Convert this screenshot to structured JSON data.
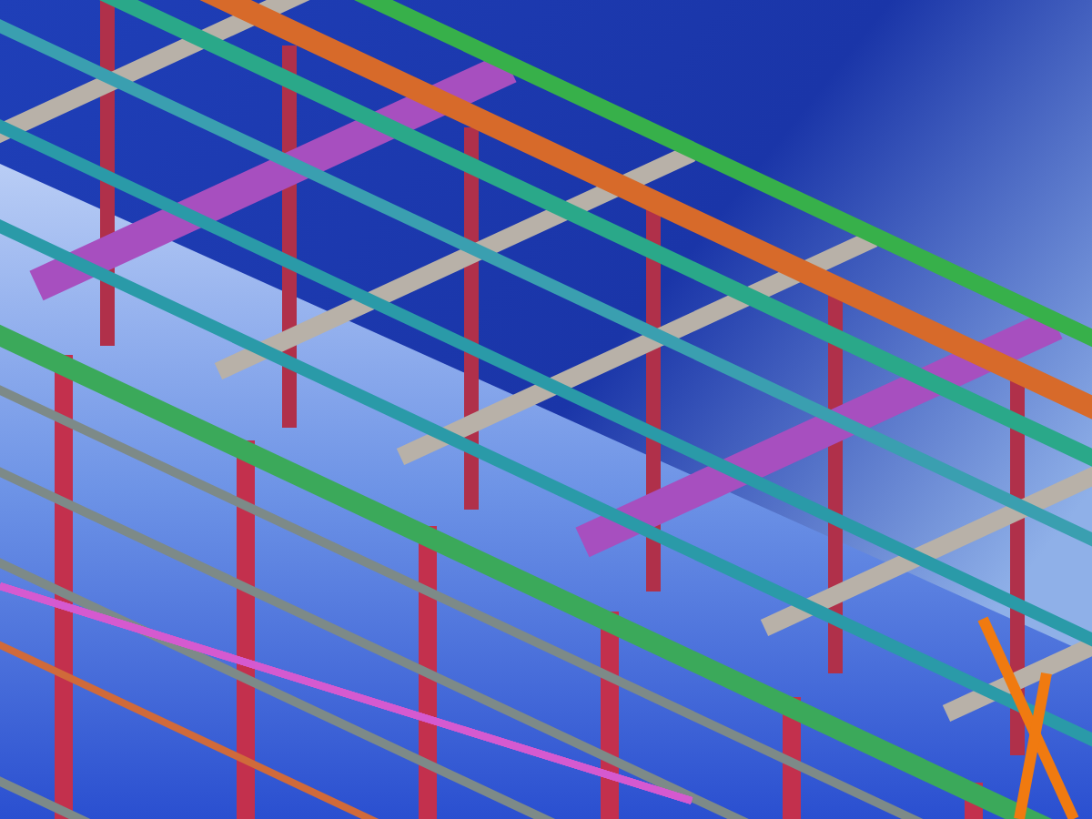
{
  "scene": {
    "kind": "steel-frame"
  }
}
